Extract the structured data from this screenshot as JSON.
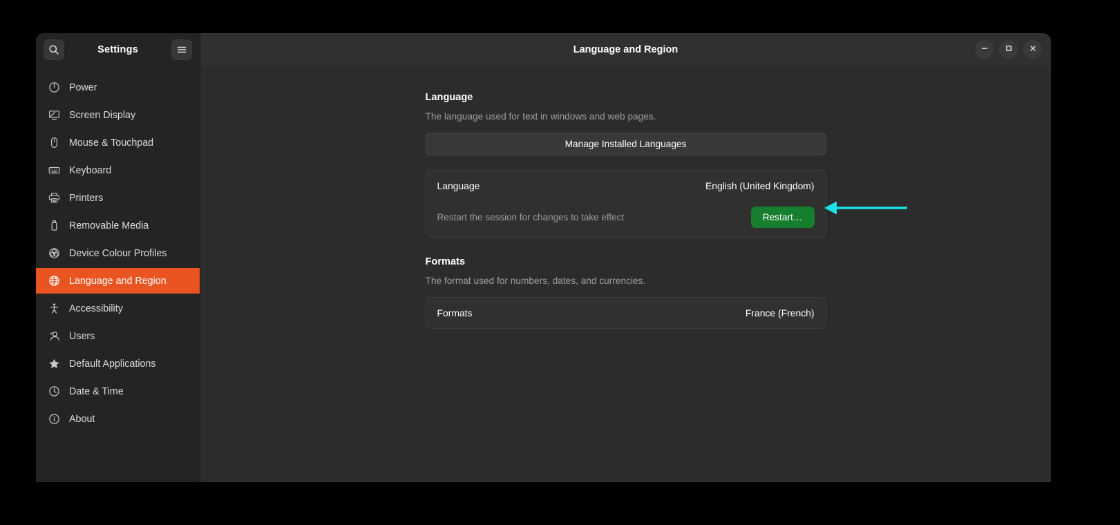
{
  "window": {
    "title": "Language and Region",
    "app_name": "Settings",
    "controls": {
      "minimize": "minimize-icon",
      "maximize": "maximize-icon",
      "close": "close-icon"
    },
    "search_icon": "search-icon",
    "menu_icon": "hamburger-menu-icon"
  },
  "sidebar": {
    "items": [
      {
        "label": "Power",
        "icon": "power-icon",
        "selected": false
      },
      {
        "label": "Screen Display",
        "icon": "display-icon",
        "selected": false
      },
      {
        "label": "Mouse & Touchpad",
        "icon": "mouse-icon",
        "selected": false
      },
      {
        "label": "Keyboard",
        "icon": "keyboard-icon",
        "selected": false
      },
      {
        "label": "Printers",
        "icon": "printer-icon",
        "selected": false
      },
      {
        "label": "Removable Media",
        "icon": "usb-drive-icon",
        "selected": false
      },
      {
        "label": "Device Colour Profiles",
        "icon": "colour-profile-icon",
        "selected": false
      },
      {
        "label": "Language and Region",
        "icon": "globe-icon",
        "selected": true
      },
      {
        "label": "Accessibility",
        "icon": "accessibility-icon",
        "selected": false
      },
      {
        "label": "Users",
        "icon": "users-icon",
        "selected": false
      },
      {
        "label": "Default Applications",
        "icon": "star-icon",
        "selected": false
      },
      {
        "label": "Date & Time",
        "icon": "clock-icon",
        "selected": false
      },
      {
        "label": "About",
        "icon": "info-icon",
        "selected": false
      }
    ]
  },
  "main": {
    "language_section": {
      "title": "Language",
      "description": "The language used for text in windows and web pages.",
      "manage_button": "Manage Installed Languages",
      "row_label": "Language",
      "row_value": "English (United Kingdom)",
      "restart_note": "Restart the session for changes to take effect",
      "restart_button": "Restart…"
    },
    "formats_section": {
      "title": "Formats",
      "description": "The format used for numbers, dates, and currencies.",
      "row_label": "Formats",
      "row_value": "France (French)"
    }
  },
  "annotation": {
    "arrow": "pointer-arrow",
    "target": "restart-button",
    "colour": "#18e1ea"
  },
  "colors": {
    "accent": "#e95420",
    "window_bg": "#2c2c2c",
    "sidebar_bg": "#242424",
    "header_bg": "#303030",
    "restart_green": "#157f2d",
    "annotation_cyan": "#18e1ea"
  }
}
